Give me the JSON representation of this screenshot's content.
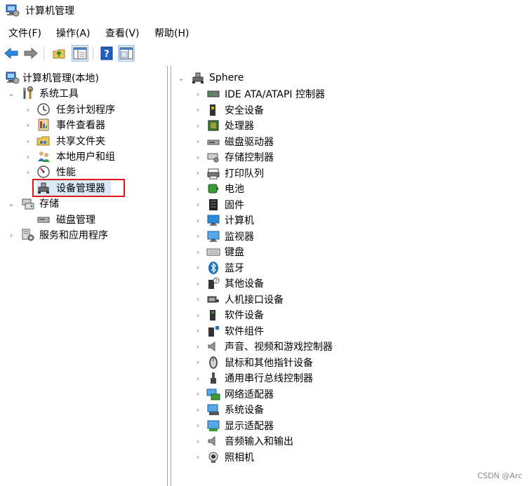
{
  "window": {
    "title": "计算机管理"
  },
  "menu": [
    "文件(F)",
    "操作(A)",
    "查看(V)",
    "帮助(H)"
  ],
  "left_tree": {
    "root": "计算机管理(本地)",
    "system_tools": "系统工具",
    "system_tools_children": [
      "任务计划程序",
      "事件查看器",
      "共享文件夹",
      "本地用户和组",
      "性能",
      "设备管理器"
    ],
    "storage": "存储",
    "storage_children": [
      "磁盘管理"
    ],
    "services": "服务和应用程序"
  },
  "right_tree": {
    "root": "Sphere",
    "categories": [
      "IDE ATA/ATAPI 控制器",
      "安全设备",
      "处理器",
      "磁盘驱动器",
      "存储控制器",
      "打印队列",
      "电池",
      "固件",
      "计算机",
      "监视器",
      "键盘",
      "蓝牙",
      "其他设备",
      "人机接口设备",
      "软件设备",
      "软件组件",
      "声音、视频和游戏控制器",
      "鼠标和其他指针设备",
      "通用串行总线控制器",
      "网络适配器",
      "系统设备",
      "显示适配器",
      "音频输入和输出",
      "照相机"
    ]
  },
  "watermark": "CSDN @Arc",
  "colors": {
    "highlight": "#e0181e",
    "selection": "#d9ebf9",
    "accent": "#1e73be"
  }
}
